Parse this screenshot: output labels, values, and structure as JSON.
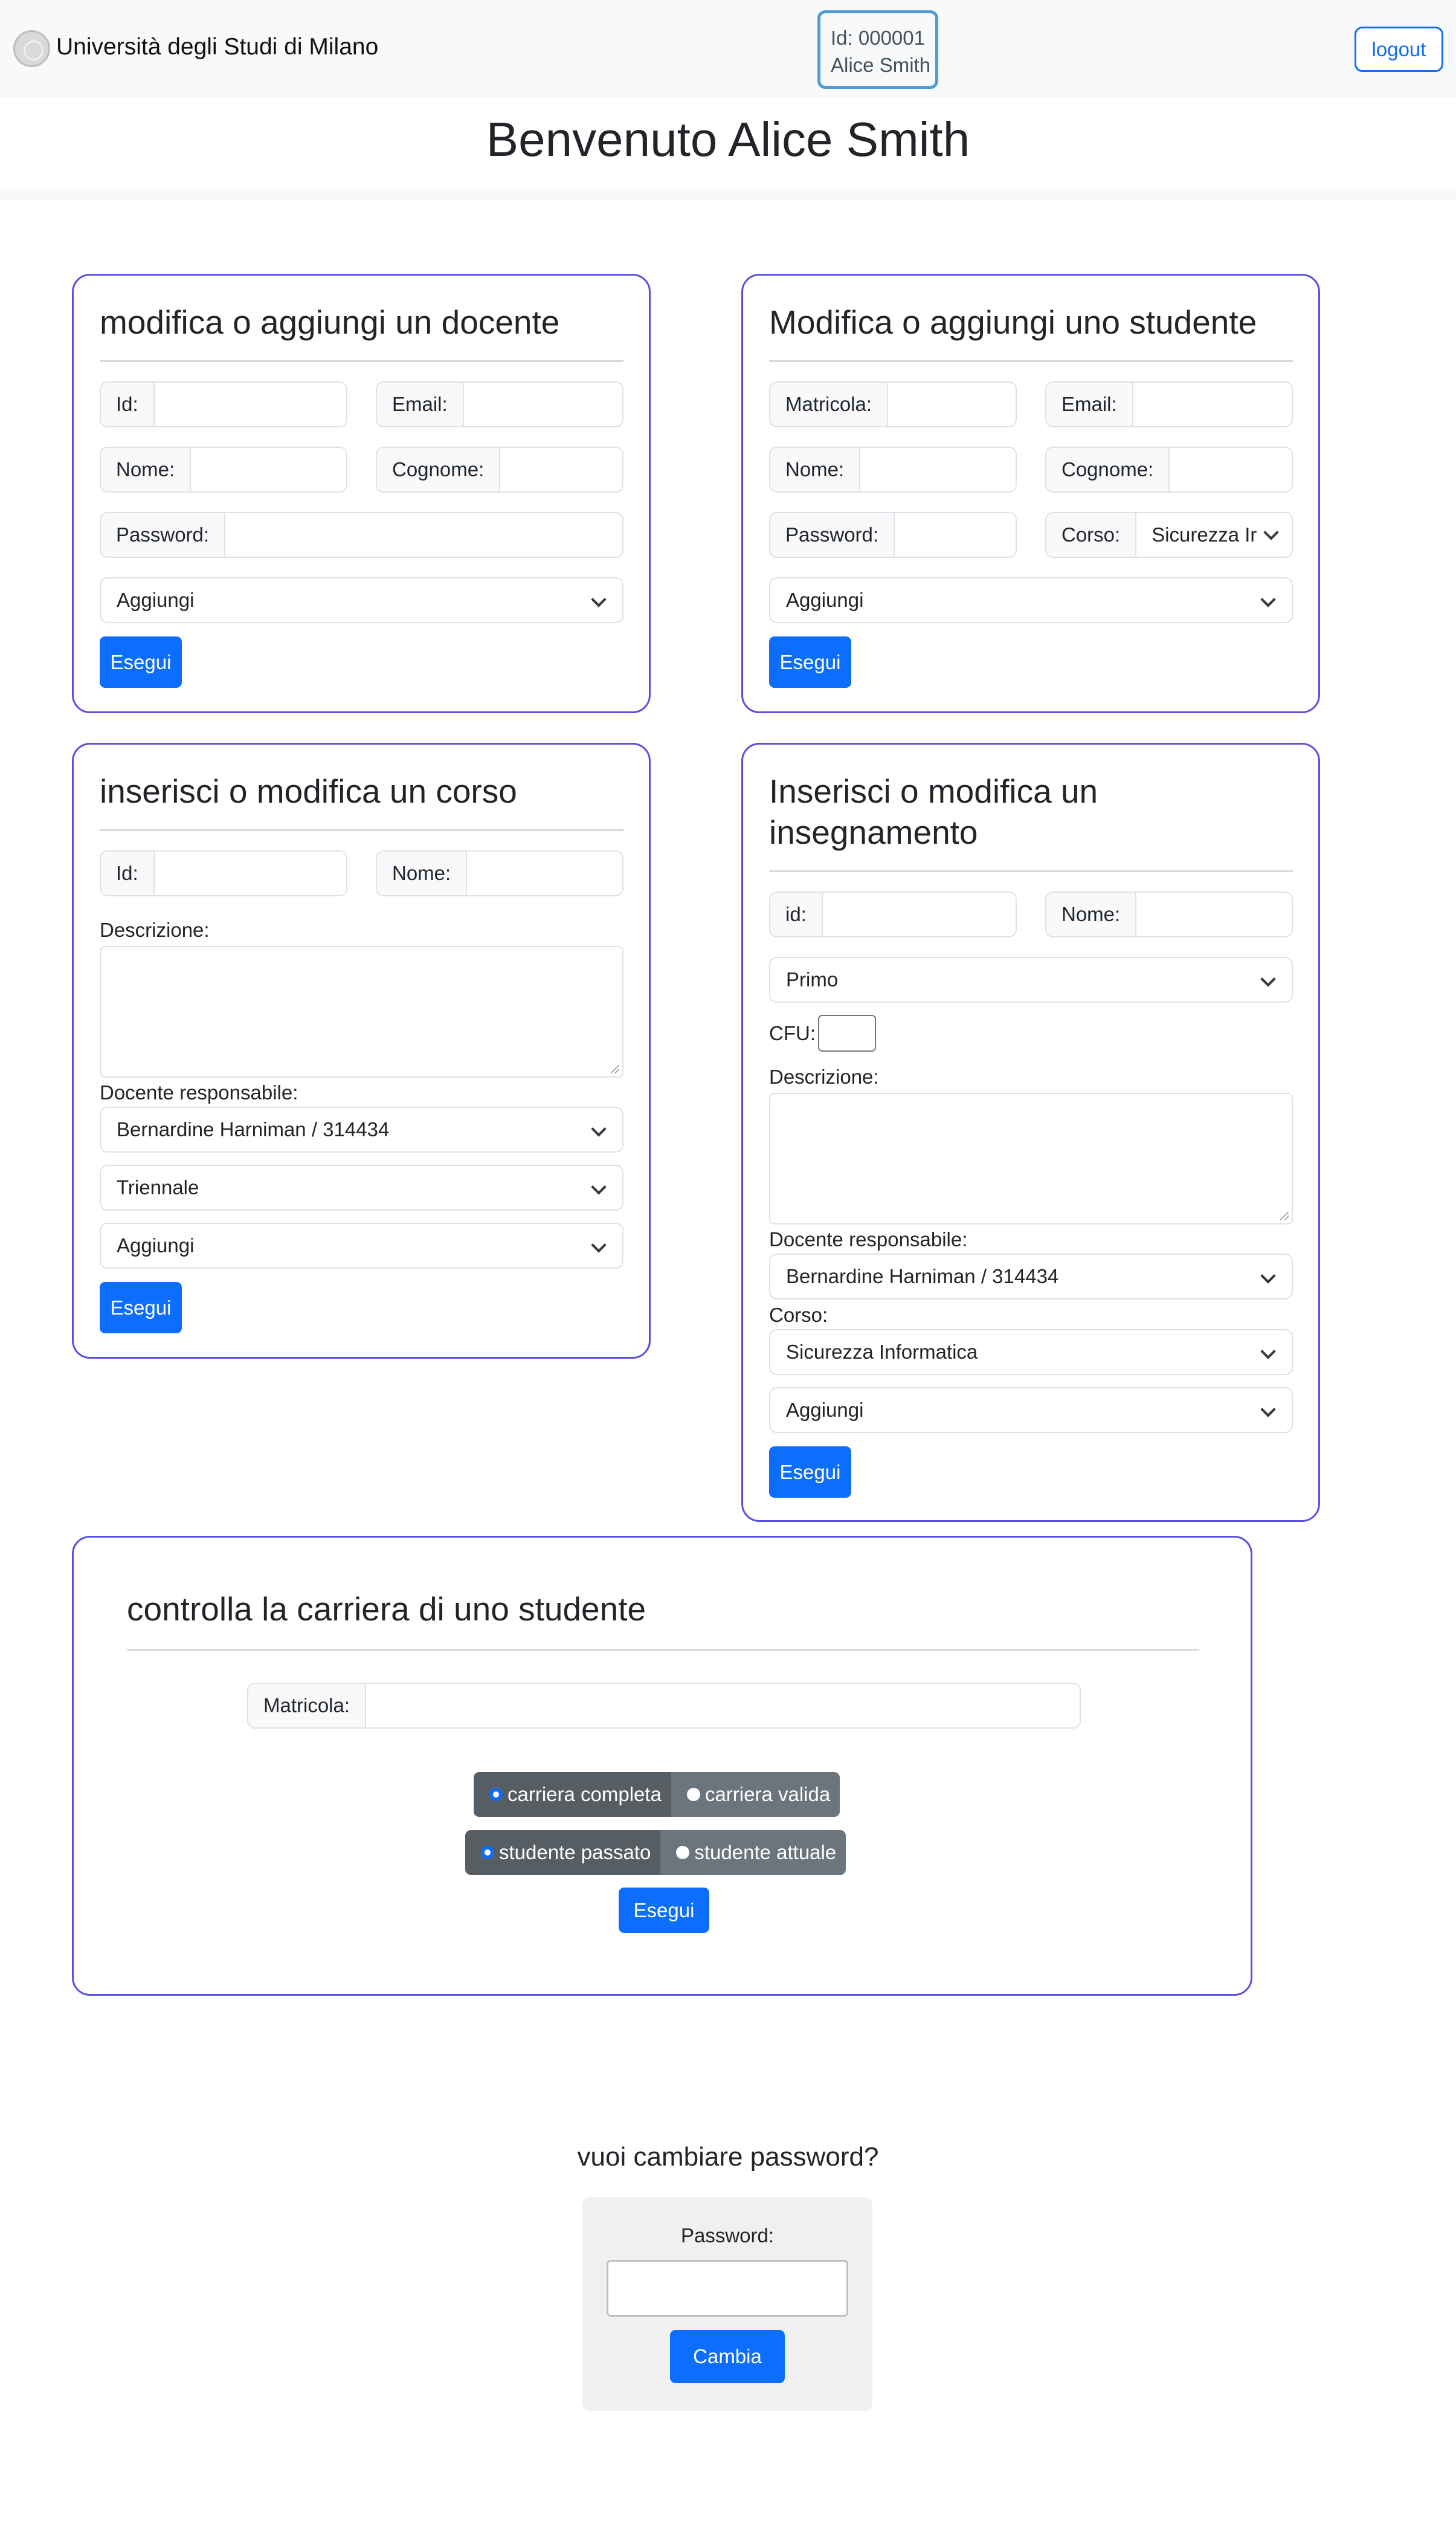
{
  "header": {
    "brand": "Università degli Studi di Milano",
    "user_id": "Id: 000001",
    "user_name": "Alice Smith",
    "logout_label": "logout"
  },
  "welcome": "Benvenuto Alice Smith",
  "docente_card": {
    "title": "modifica o aggiungi un docente",
    "id_label": "Id:",
    "email_label": "Email:",
    "nome_label": "Nome:",
    "cognome_label": "Cognome:",
    "password_label": "Password:",
    "action_select": "Aggiungi",
    "submit_label": "Esegui"
  },
  "studente_card": {
    "title": "Modifica o aggiungi uno studente",
    "matricola_label": "Matricola:",
    "email_label": "Email:",
    "nome_label": "Nome:",
    "cognome_label": "Cognome:",
    "password_label": "Password:",
    "corso_label": "Corso:",
    "corso_value": "Sicurezza Ir",
    "action_select": "Aggiungi",
    "submit_label": "Esegui"
  },
  "corso_card": {
    "title": "inserisci o modifica un corso",
    "id_label": "Id:",
    "nome_label": "Nome:",
    "descrizione_label": "Descrizione:",
    "docente_label": "Docente responsabile:",
    "docente_value": "Bernardine Harniman / 314434",
    "tipo_value": "Triennale",
    "action_select": "Aggiungi",
    "submit_label": "Esegui"
  },
  "insegnamento_card": {
    "title_line1": "Inserisci o modifica un",
    "title_line2": "insegnamento",
    "id_label": "id:",
    "nome_label": "Nome:",
    "anno_value": "Primo",
    "cfu_label": "CFU:",
    "descrizione_label": "Descrizione:",
    "docente_label": "Docente responsabile:",
    "docente_value": "Bernardine Harniman / 314434",
    "corso_label": "Corso:",
    "corso_value": "Sicurezza Informatica",
    "action_select": "Aggiungi",
    "submit_label": "Esegui"
  },
  "carriera_card": {
    "title": "controlla la carriera di uno studente",
    "matricola_label": "Matricola:",
    "options_row1": [
      "carriera completa",
      "carriera valida"
    ],
    "options_row2": [
      "studente passato",
      "studente attuale"
    ],
    "submit_label": "Esegui"
  },
  "password_section": {
    "heading": "vuoi cambiare password?",
    "label": "Password:",
    "submit_label": "Cambia"
  },
  "colors": {
    "primary": "#0d6efd",
    "card_border": "#5a4fe3",
    "navbar_bg": "#f8f9fa",
    "radio_dark": "#565e64",
    "radio_light": "#6c757d"
  }
}
